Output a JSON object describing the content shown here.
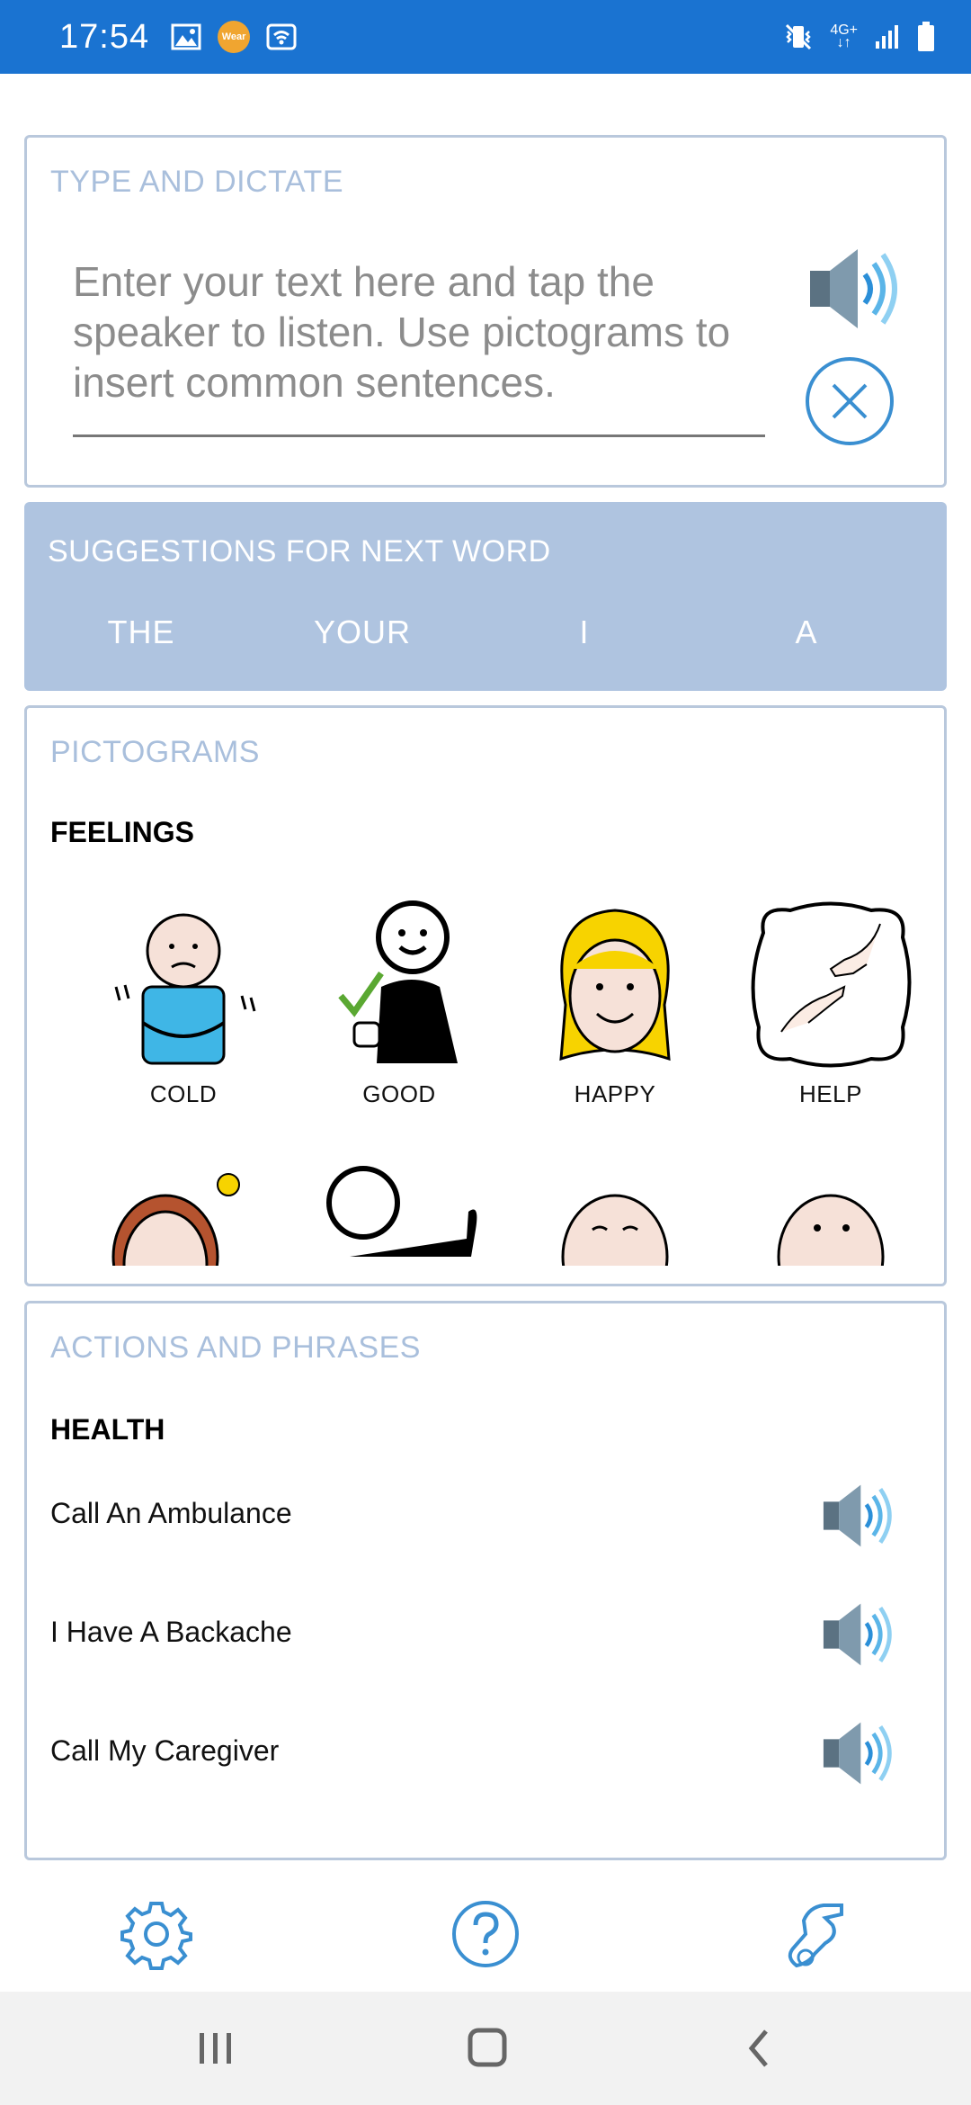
{
  "status_bar": {
    "time": "17:54",
    "left_icons": [
      "image-icon",
      "wear-icon",
      "wifi-calling-icon"
    ],
    "wear_label": "Wear",
    "network_label": "4G+",
    "right_icons": [
      "vibrate-icon",
      "network-4g-icon",
      "signal-icon",
      "battery-icon"
    ]
  },
  "type_dictate": {
    "title": "TYPE AND DICTATE",
    "placeholder": "Enter your text here and tap the speaker to listen. Use pictograms to insert common sentences."
  },
  "suggestions": {
    "title": "SUGGESTIONS FOR NEXT WORD",
    "words": [
      "THE",
      "YOUR",
      "I",
      "A"
    ]
  },
  "pictograms": {
    "title": "PICTOGRAMS",
    "category": "FEELINGS",
    "items": [
      {
        "label": "COLD",
        "icon": "cold-person-icon"
      },
      {
        "label": "GOOD",
        "icon": "good-thumbs-up-icon"
      },
      {
        "label": "HAPPY",
        "icon": "happy-face-icon"
      },
      {
        "label": "HELP",
        "icon": "helping-hands-icon"
      }
    ]
  },
  "actions": {
    "title": "ACTIONS AND PHRASES",
    "category": "HEALTH",
    "phrases": [
      "Call An Ambulance",
      "I Have A Backache",
      "Call My Caregiver"
    ]
  },
  "toolbar": {
    "icons": [
      "settings-gear-icon",
      "help-question-icon",
      "sign-language-hand-icon"
    ]
  },
  "nav_bar": {
    "icons": [
      "recent-apps-icon",
      "home-icon",
      "back-icon"
    ]
  },
  "colors": {
    "status_bar": "#1a73d1",
    "card_border": "#b9c8dc",
    "title_blue": "#a9bfdc",
    "suggest_bg": "#afc4e0",
    "accent": "#3a8fd1"
  }
}
